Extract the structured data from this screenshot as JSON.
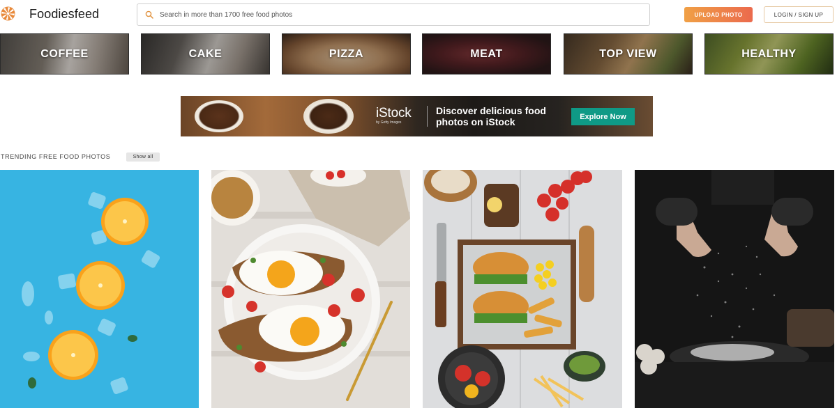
{
  "header": {
    "logo_text": "Foodiesfeed",
    "search_placeholder": "Search in more than 1700 free food photos",
    "upload_label": "UPLOAD PHOTO",
    "login_label": "LOGIN / SIGN UP"
  },
  "categories": [
    {
      "label": "COFFEE"
    },
    {
      "label": "CAKE"
    },
    {
      "label": "PIZZA"
    },
    {
      "label": "MEAT"
    },
    {
      "label": "TOP VIEW"
    },
    {
      "label": "HEALTHY"
    }
  ],
  "banner": {
    "brand": "iStock",
    "brand_sub": "by Getty Images",
    "headline": "Discover delicious food photos on iStock",
    "cta": "Explore Now"
  },
  "trending": {
    "title": "TRENDING FREE FOOD PHOTOS",
    "show_all": "Show all"
  },
  "photos": [
    {
      "subject": "orange slices on blue background"
    },
    {
      "subject": "avocado toast with fried eggs"
    },
    {
      "subject": "burger and fries platter top view"
    },
    {
      "subject": "hands sprinkling flour"
    }
  ],
  "colors": {
    "upload_gradient_start": "#f0a045",
    "upload_gradient_end": "#eb6a4d",
    "cta": "#0f9a86",
    "logo_orange": "#e8893a"
  },
  "icons": [
    "logo-mark-icon",
    "search-icon"
  ]
}
